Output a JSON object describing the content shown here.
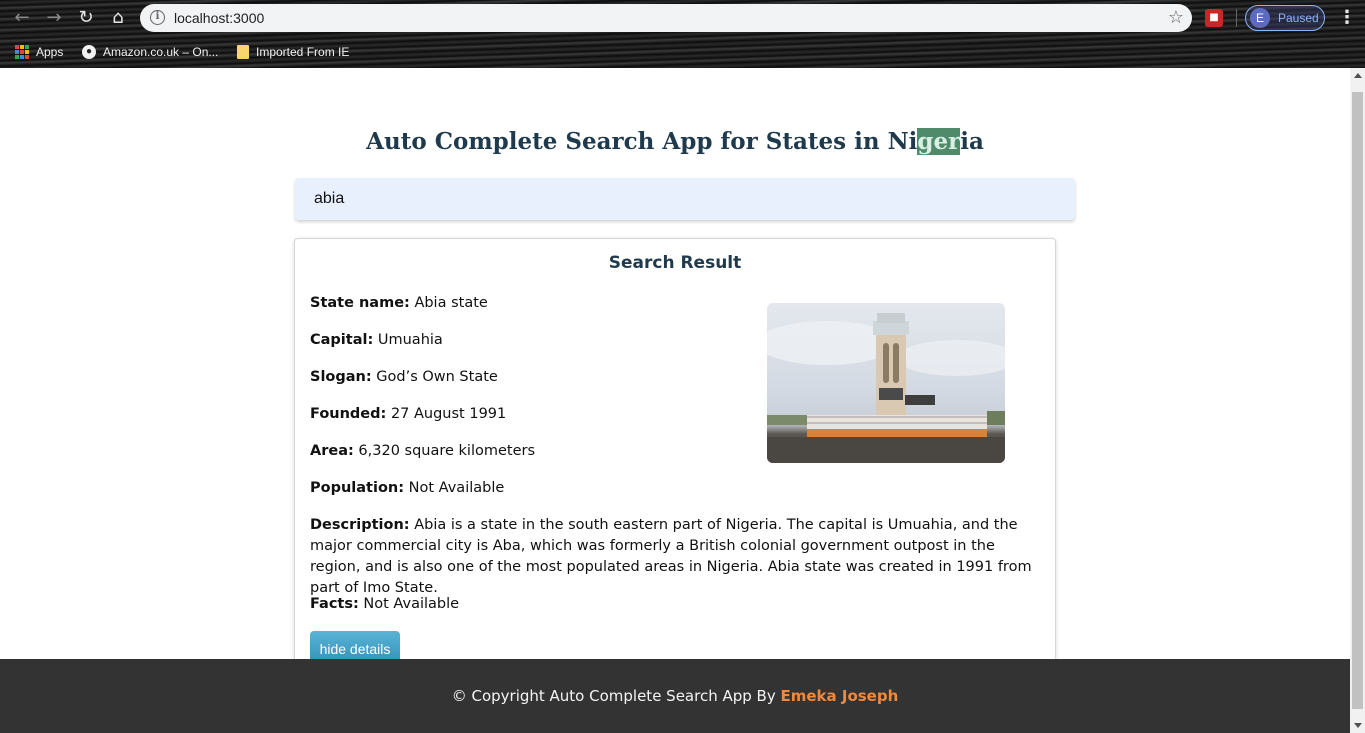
{
  "browser": {
    "url": "localhost:3000",
    "profile_initial": "E",
    "profile_status": "Paused",
    "bookmarks": [
      {
        "label": "Apps",
        "icon": "apps-grid-icon"
      },
      {
        "label": "Amazon.co.uk – On...",
        "icon": "globe-icon"
      },
      {
        "label": "Imported From IE",
        "icon": "folder-icon"
      }
    ]
  },
  "page": {
    "title_before": "Auto Complete Search App for States in Ni",
    "title_highlight": "ger",
    "title_after": "ia",
    "search_value": "abia",
    "result": {
      "heading": "Search Result",
      "state_label": "State name:",
      "state_value": "Abia state",
      "capital_label": "Capital:",
      "capital_value": "Umuahia",
      "slogan_label": "Slogan:",
      "slogan_value": "God’s Own State",
      "founded_label": "Founded:",
      "founded_value": "27 August 1991",
      "area_label": "Area:",
      "area_value": "6,320 square kilometers",
      "population_label": "Population:",
      "population_value": "Not Available",
      "description_label": "Description:",
      "description_value": "Abia is a state in the south eastern part of Nigeria. The capital is Umuahia, and the major commercial city is Aba, which was formerly a British colonial government outpost in the region, and is also one of the most populated areas in Nigeria. Abia state was created in 1991 from part of Imo State.",
      "facts_label": "Facts:",
      "facts_value": "Not Available",
      "hide_button": "hide details"
    },
    "footer": {
      "text": "© Copyright Auto Complete Search App By ",
      "author": "Emeka Joseph"
    }
  }
}
